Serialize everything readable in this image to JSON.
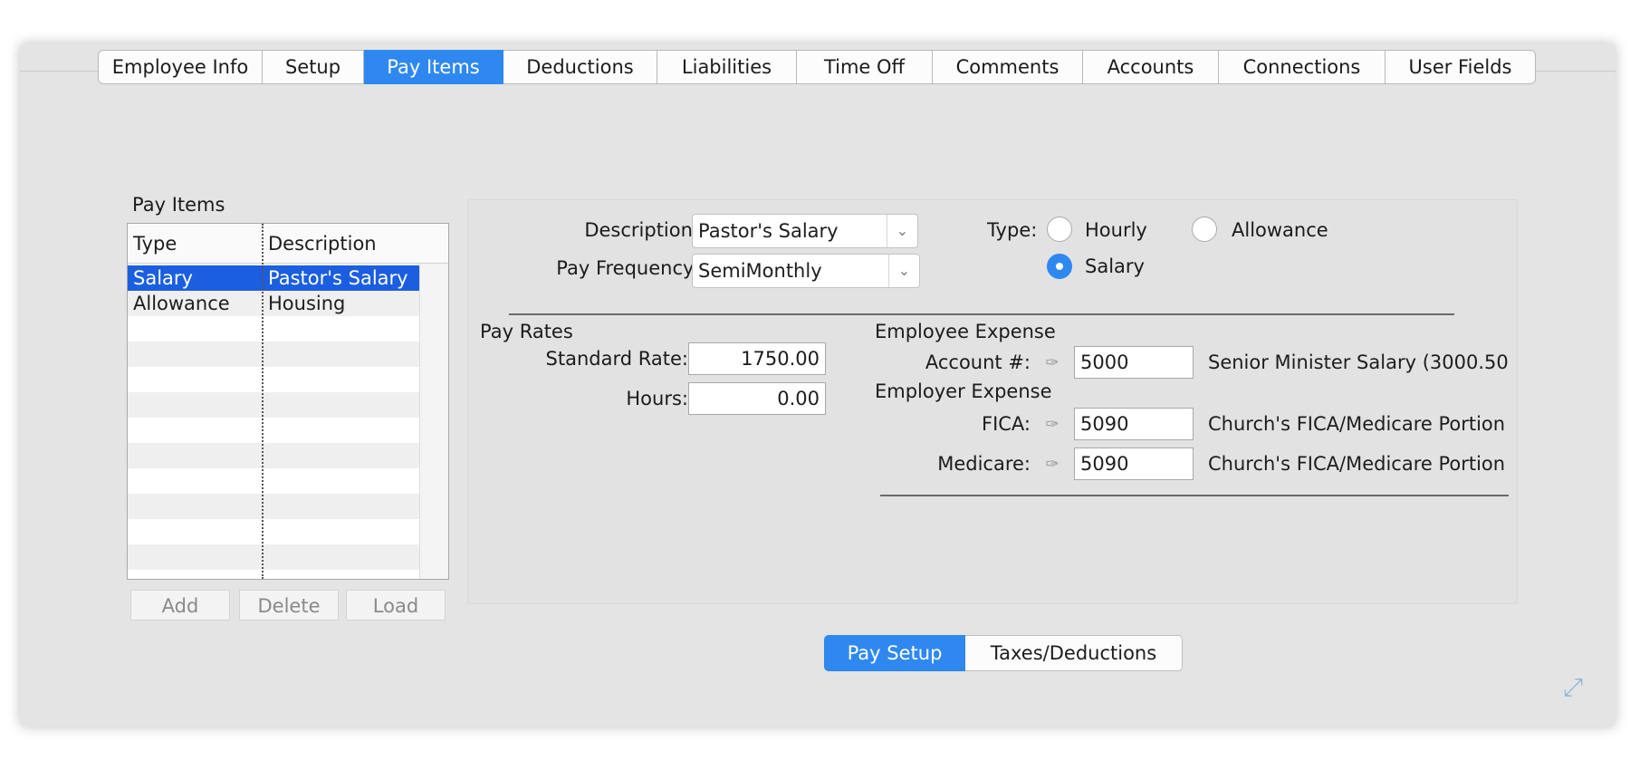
{
  "tabs": [
    {
      "label": "Employee Info",
      "active": false
    },
    {
      "label": "Setup",
      "active": false
    },
    {
      "label": "Pay Items",
      "active": true
    },
    {
      "label": "Deductions",
      "active": false
    },
    {
      "label": "Liabilities",
      "active": false
    },
    {
      "label": "Time Off",
      "active": false
    },
    {
      "label": "Comments",
      "active": false
    },
    {
      "label": "Accounts",
      "active": false
    },
    {
      "label": "Connections",
      "active": false
    },
    {
      "label": "User Fields",
      "active": false
    }
  ],
  "pay_items": {
    "title": "Pay Items",
    "columns": {
      "type": "Type",
      "description": "Description"
    },
    "rows": [
      {
        "type": "Salary",
        "description": "Pastor's Salary",
        "selected": true
      },
      {
        "type": "Allowance",
        "description": "Housing",
        "selected": false
      }
    ],
    "buttons": {
      "add": "Add",
      "delete": "Delete",
      "load": "Load"
    }
  },
  "form": {
    "description_label": "Description:",
    "description_value": "Pastor's Salary",
    "frequency_label": "Pay Frequency:",
    "frequency_value": "SemiMonthly",
    "type_label": "Type:",
    "type_options": {
      "hourly": "Hourly",
      "allowance": "Allowance",
      "salary": "Salary"
    },
    "type_selected": "salary"
  },
  "pay_rates": {
    "title": "Pay Rates",
    "standard_rate_label": "Standard Rate:",
    "standard_rate_value": "1750.00",
    "hours_label": "Hours:",
    "hours_value": "0.00"
  },
  "employee_expense": {
    "title": "Employee Expense",
    "account_label": "Account #:",
    "account_value": "5000",
    "account_name": "Senior Minister Salary (3000.50"
  },
  "employer_expense": {
    "title": "Employer Expense",
    "fica_label": "FICA:",
    "fica_value": "5090",
    "fica_name": "Church's FICA/Medicare Portion",
    "medicare_label": "Medicare:",
    "medicare_value": "5090",
    "medicare_name": "Church's FICA/Medicare Portion"
  },
  "bottom_tabs": {
    "pay_setup": "Pay Setup",
    "taxes": "Taxes/Deductions"
  },
  "colors": {
    "accent": "#2f88f0",
    "selection": "#1b5ee0"
  }
}
